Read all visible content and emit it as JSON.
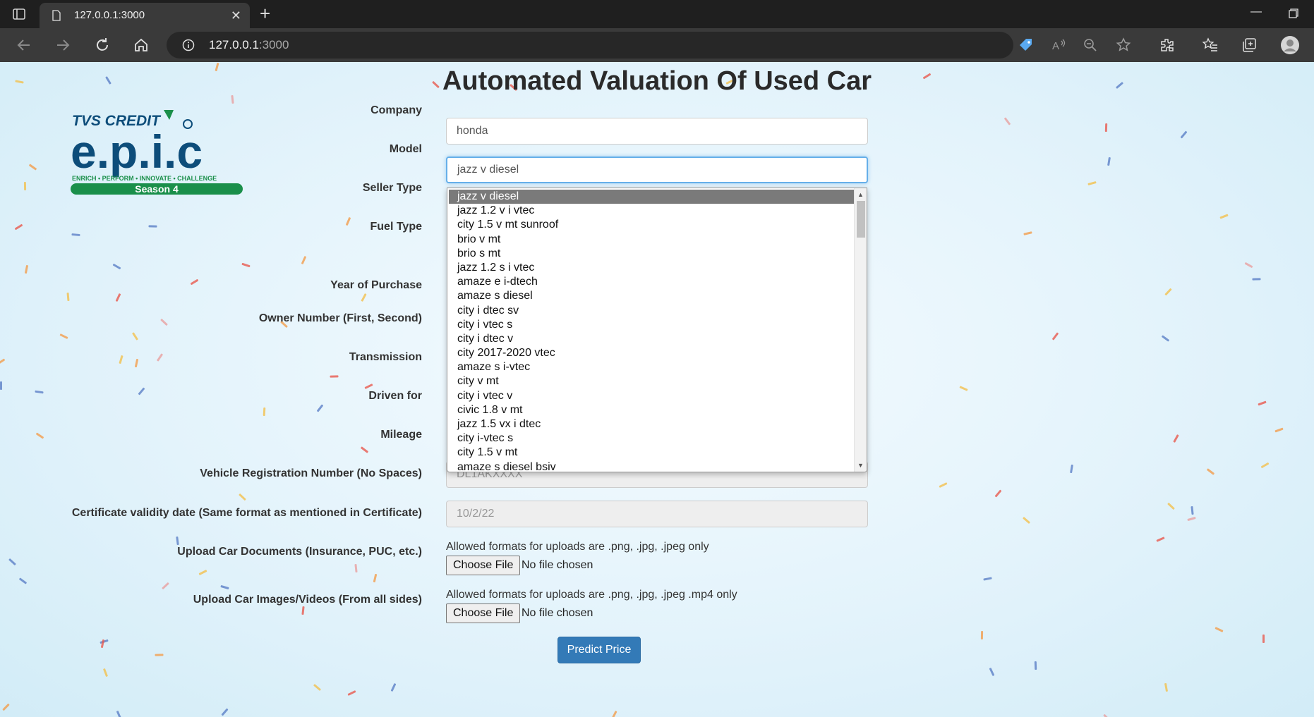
{
  "browser": {
    "tab_title": "127.0.0.1:3000",
    "url_host": "127.0.0.1",
    "url_port": ":3000"
  },
  "page": {
    "title": "Automated Valuation Of Used Car",
    "logo": {
      "brand": "TVS CREDIT",
      "name": "e.p.i.c",
      "tagline": "ENRICH • PERFORM • INNOVATE • CHALLENGE",
      "season": "Season 4"
    }
  },
  "form": {
    "company_label": "Company",
    "company_value": "honda",
    "model_label": "Model",
    "model_value": "jazz v diesel",
    "seller_type_label": "Seller Type",
    "fuel_type_label": "Fuel Type",
    "year_label": "Year of Purchase",
    "owner_label": "Owner Number (First, Second)",
    "transmission_label": "Transmission",
    "driven_label": "Driven for",
    "mileage_label": "Mileage",
    "registration_label": "Vehicle Registration Number (No Spaces)",
    "registration_placeholder": "DL1AKXXXX",
    "certificate_label": "Certificate validity date (Same format as mentioned in Certificate)",
    "certificate_placeholder": "10/2/22",
    "documents_label": "Upload Car Documents (Insurance, PUC, etc.)",
    "documents_hint": "Allowed formats for uploads are .png, .jpg, .jpeg only",
    "images_label": "Upload Car Images/Videos (From all sides)",
    "images_hint": "Allowed formats for uploads are .png, .jpg, .jpeg .mp4 only",
    "choose_file_label": "Choose File",
    "no_file_text": "No file chosen",
    "predict_label": "Predict Price"
  },
  "model_options": [
    "jazz v diesel",
    "jazz 1.2 v i vtec",
    "city 1.5 v mt sunroof",
    "brio v mt",
    "brio s mt",
    "jazz 1.2 s i vtec",
    "amaze e i-dtech",
    "amaze s diesel",
    "city i dtec sv",
    "city i vtec s",
    "city i dtec v",
    "city 2017-2020 vtec",
    "amaze s i-vtec",
    "city v mt",
    "city i vtec v",
    "civic 1.8 v mt",
    "jazz 1.5 vx i dtec",
    "city i-vtec s",
    "city 1.5 v mt",
    "amaze s diesel bsiv"
  ],
  "model_selected_index": 0,
  "colors": {
    "primary_button": "#337ab7",
    "focus_ring": "#66afe9",
    "logo_blue": "#0d4d7a",
    "logo_green": "#1a8f4a"
  }
}
